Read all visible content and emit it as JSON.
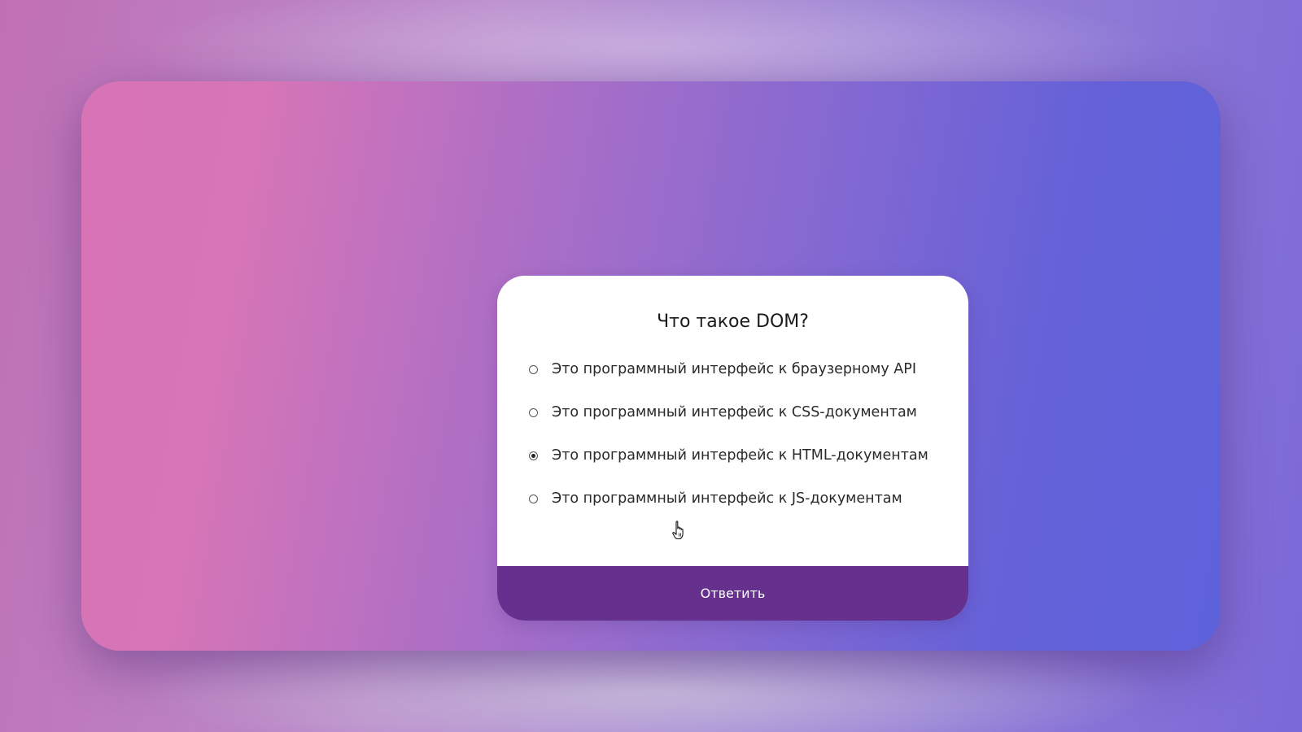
{
  "quiz": {
    "question": "Что такое DOM?",
    "options": [
      {
        "label": "Это программный интерфейс к браузерному API",
        "selected": false
      },
      {
        "label": "Это программный интерфейс к CSS-документам",
        "selected": false
      },
      {
        "label": "Это программный интерфейс к HTML-документам",
        "selected": true
      },
      {
        "label": "Это программный интерфейс к JS-документам",
        "selected": false
      }
    ],
    "submit_label": "Ответить"
  },
  "colors": {
    "button": "#66308e",
    "card": "#ffffff",
    "gradient_left": "#d873b6",
    "gradient_right": "#5e62da"
  },
  "icons": {
    "cursor": "hand-pointer-icon"
  }
}
